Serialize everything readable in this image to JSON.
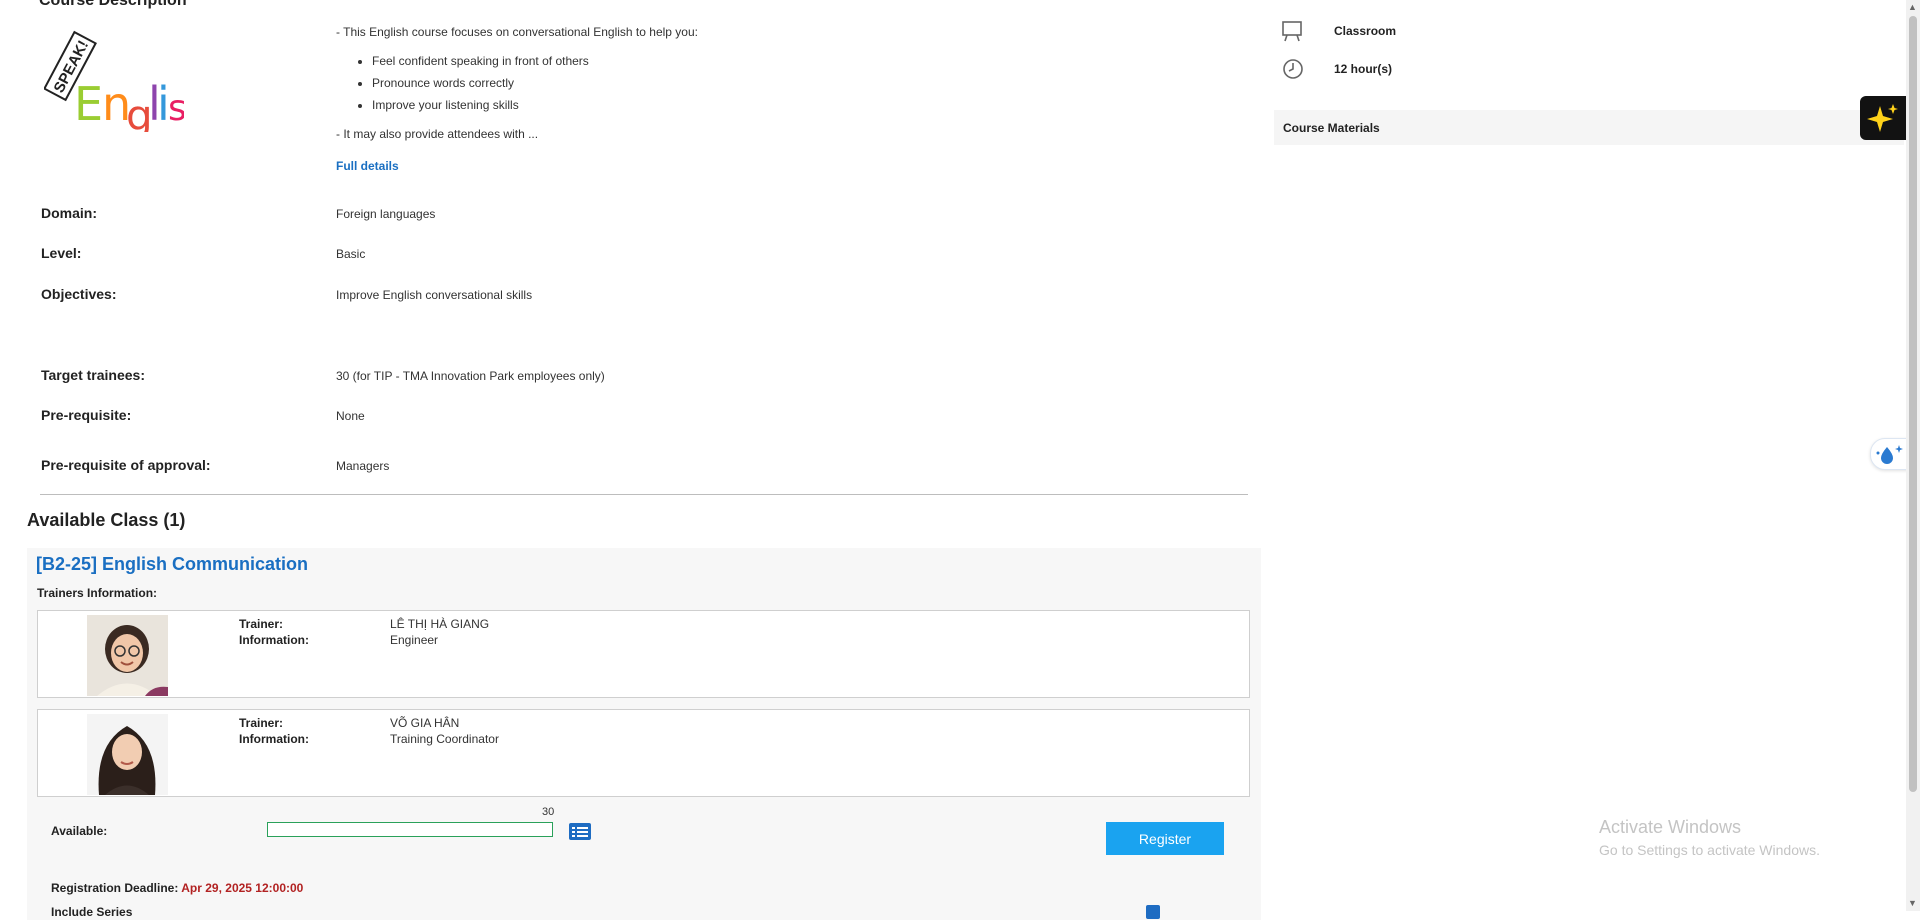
{
  "course": {
    "heading": "Course Description",
    "intro": "- This English course focuses on conversational English to help you:",
    "bullets": [
      "Feel confident speaking in front of others",
      "Pronounce words correctly",
      "Improve your listening skills"
    ],
    "extra": "- It may also provide attendees with ...",
    "full_details": "Full details",
    "logo_text_1": "SPEAK!",
    "logo_text_2": "English"
  },
  "info": [
    {
      "label": "Domain:",
      "value": "Foreign languages"
    },
    {
      "label": "Level:",
      "value": "Basic"
    },
    {
      "label": "Objectives:",
      "value": "Improve English conversational skills"
    },
    {
      "label": "Target trainees:",
      "value": "30 (for TIP - TMA Innovation Park employees only)"
    },
    {
      "label": "Pre-requisite:",
      "value": "None"
    },
    {
      "label": "Pre-requisite of approval:",
      "value": "Managers"
    }
  ],
  "side": {
    "type_icon": "easel-icon",
    "type": "Classroom",
    "duration_icon": "clock-icon",
    "duration": "12 hour(s)",
    "materials": "Course Materials"
  },
  "available": {
    "title": "Available Class (1)",
    "class_title": "[B2-25] English Communication",
    "trainers_info": "Trainers Information:",
    "trainers": [
      {
        "trainer_label": "Trainer:",
        "name": "LÊ THỊ HÀ GIANG",
        "info_label": "Information:",
        "info": "Engineer"
      },
      {
        "trainer_label": "Trainer:",
        "name": "VÕ GIA HÂN",
        "info_label": "Information:",
        "info": "Training Coordinator"
      }
    ],
    "available_label": "Available:",
    "capacity": "30",
    "progress_fraction": 0,
    "register": "Register",
    "deadline_label": "Registration Deadline:",
    "deadline": "Apr 29, 2025 12:00:00",
    "include_label": "Include Series"
  },
  "windows": {
    "line1": "Activate Windows",
    "line2": "Go to Settings to activate Windows."
  },
  "colors": {
    "accent": "#1a6fc2",
    "register": "#1aa3f0",
    "deadline": "#b22222"
  }
}
